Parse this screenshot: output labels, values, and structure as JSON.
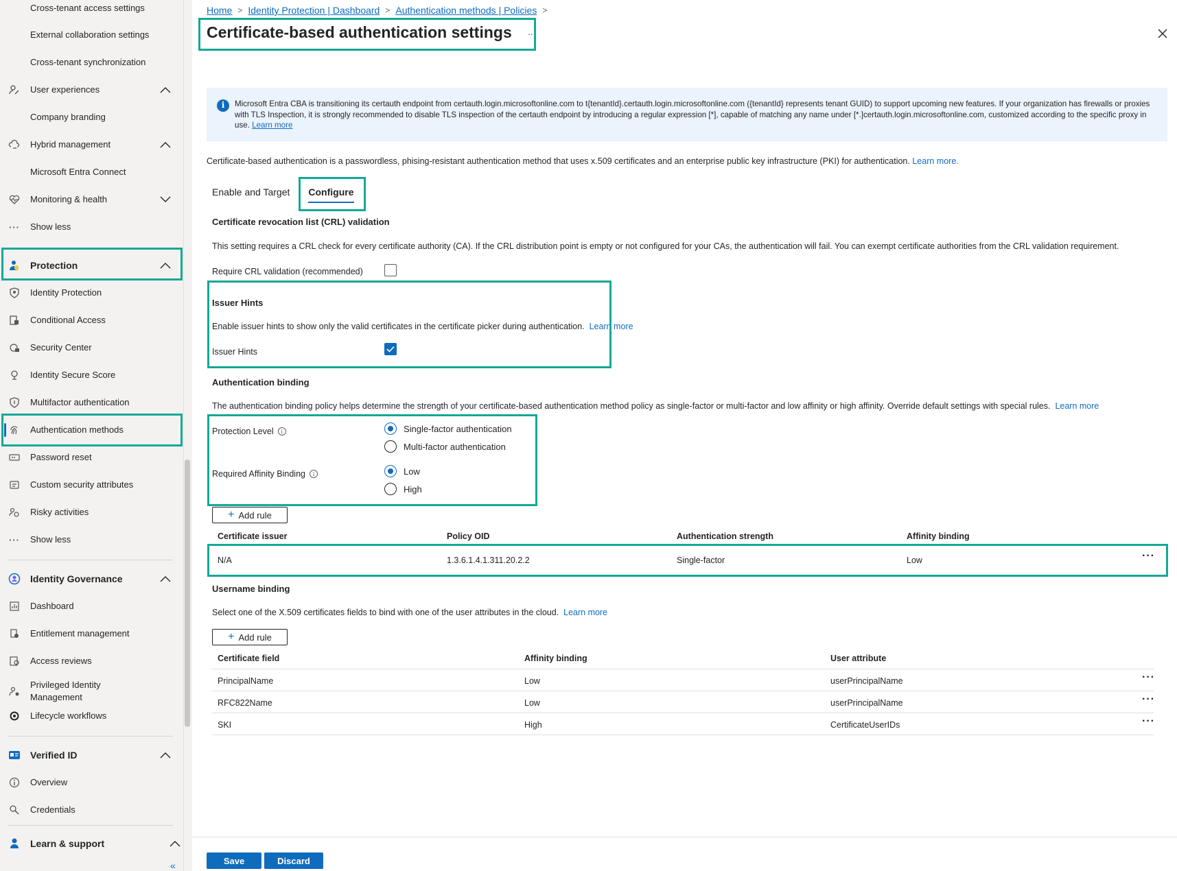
{
  "sidebar": {
    "items": [
      {
        "label": "Cross-tenant access settings",
        "icon": "none"
      },
      {
        "label": "External collaboration settings",
        "icon": "none"
      },
      {
        "label": "Cross-tenant synchronization",
        "icon": "none"
      },
      {
        "label": "User experiences",
        "icon": "user-experience-icon"
      },
      {
        "label": "Company branding",
        "icon": "none"
      },
      {
        "label": "Hybrid management",
        "icon": "cloud-sync-icon"
      },
      {
        "label": "Microsoft Entra Connect",
        "icon": "none"
      },
      {
        "label": "Monitoring & health",
        "icon": "heart-pulse-icon"
      },
      {
        "label": "Show less",
        "icon": "ellipsis-icon"
      },
      {
        "label": "Protection",
        "icon": "protection-icon"
      },
      {
        "label": "Identity Protection",
        "icon": "shield-icon"
      },
      {
        "label": "Conditional Access",
        "icon": "lock-doc-icon"
      },
      {
        "label": "Security Center",
        "icon": "lock-icon"
      },
      {
        "label": "Identity Secure Score",
        "icon": "trophy-icon"
      },
      {
        "label": "Multifactor authentication",
        "icon": "shield-key-icon"
      },
      {
        "label": "Authentication methods",
        "icon": "fingerprint-icon"
      },
      {
        "label": "Password reset",
        "icon": "password-icon"
      },
      {
        "label": "Custom security attributes",
        "icon": "tag-icon"
      },
      {
        "label": "Risky activities",
        "icon": "risky-users-icon"
      },
      {
        "label": "Show less",
        "icon": "ellipsis-icon"
      },
      {
        "label": "Identity Governance",
        "icon": "governance-icon"
      },
      {
        "label": "Dashboard",
        "icon": "dashboard-icon"
      },
      {
        "label": "Entitlement management",
        "icon": "entitlement-icon"
      },
      {
        "label": "Access reviews",
        "icon": "access-review-icon"
      },
      {
        "label": "Privileged Identity Management",
        "icon": "pim-icon"
      },
      {
        "label": "Lifecycle workflows",
        "icon": "workflow-icon"
      },
      {
        "label": "Verified ID",
        "icon": "verified-id-icon"
      },
      {
        "label": "Overview",
        "icon": "info-icon"
      },
      {
        "label": "Credentials",
        "icon": "key-search-icon"
      },
      {
        "label": "Learn & support",
        "icon": "support-icon"
      }
    ]
  },
  "breadcrumb": [
    "Home",
    "Identity Protection | Dashboard",
    "Authentication methods | Policies"
  ],
  "page_title": "Certificate-based authentication settings",
  "title_more": "...",
  "info_bar": {
    "text": "Microsoft Entra CBA is transitioning its certauth endpoint from certauth.login.microsoftonline.com to t{tenantId}.certauth.login.microsoftonline.com ({tenantId} represents tenant GUID) to support upcoming new features. If your organization has firewalls or proxies with TLS Inspection, it is strongly recommended to disable TLS inspection of the certauth endpoint by introducing a regular expression [*], capable of matching any name under [*.]certauth.login.microsoftonline.com, customized according to the specific proxy in use.",
    "link": "Learn more"
  },
  "intro": {
    "text": "Certificate-based authentication is a passwordless, phising-resistant authentication method that uses x.509 certificates and an enterprise public key infrastructure (PKI) for authentication.",
    "link": "Learn more."
  },
  "tabs": [
    "Enable and Target",
    "Configure"
  ],
  "crl": {
    "heading": "Certificate revocation list (CRL) validation",
    "desc": "This setting requires a CRL check for every certificate authority (CA). If the CRL distribution point is empty or not configured for your CAs, the authentication will fail. You can exempt certificate authorities from the CRL validation requirement.",
    "label": "Require CRL validation (recommended)",
    "checked": false
  },
  "issuer_hints": {
    "heading": "Issuer Hints",
    "desc": "Enable issuer hints to show only the valid certificates in the certificate picker during authentication.",
    "link": "Learn more",
    "label": "Issuer Hints",
    "checked": true
  },
  "auth_binding": {
    "heading": "Authentication binding",
    "desc": "The authentication binding policy helps determine the strength of your certificate-based authentication method policy as single-factor or multi-factor and low affinity or high affinity. Override default settings with special rules.",
    "link": "Learn more",
    "protection_level_label": "Protection Level",
    "protection_options": [
      "Single-factor authentication",
      "Multi-factor authentication"
    ],
    "protection_selected": "Single-factor authentication",
    "affinity_label": "Required Affinity Binding",
    "affinity_options": [
      "Low",
      "High"
    ],
    "affinity_selected": "Low",
    "add_rule": "Add rule",
    "columns": [
      "Certificate issuer",
      "Policy OID",
      "Authentication strength",
      "Affinity binding"
    ],
    "rows": [
      [
        "N/A",
        "1.3.6.1.4.1.311.20.2.2",
        "Single-factor",
        "Low"
      ]
    ]
  },
  "username_binding": {
    "heading": "Username binding",
    "desc": "Select one of the X.509 certificates fields to bind with one of the user attributes in the cloud.",
    "link": "Learn more",
    "add_rule": "Add rule",
    "columns": [
      "Certificate field",
      "Affinity binding",
      "User attribute"
    ],
    "rows": [
      [
        "PrincipalName",
        "Low",
        "userPrincipalName"
      ],
      [
        "RFC822Name",
        "Low",
        "userPrincipalName"
      ],
      [
        "SKI",
        "High",
        "CertificateUserIDs"
      ]
    ]
  },
  "footer": {
    "save": "Save",
    "discard": "Discard"
  },
  "colors": {
    "accent": "#0f6cbd",
    "highlight": "#14a896",
    "info_bg": "#ebf3fc",
    "sidebar_bg": "#f3f2f1"
  }
}
